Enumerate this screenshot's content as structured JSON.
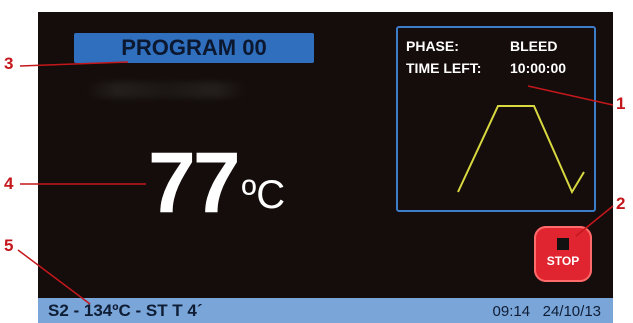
{
  "program": {
    "label": "PROGRAM 00"
  },
  "temperature": {
    "value": "77",
    "unit": "ºC"
  },
  "phase_panel": {
    "phase_label": "PHASE:",
    "phase_value": "BLEED",
    "time_label": "TIME LEFT:",
    "time_value": "10:00:00",
    "curve_color": "#d8d840"
  },
  "stop_button": {
    "label": "STOP",
    "color": "#e02530"
  },
  "status_bar": {
    "cycle": "S2 - 134ºC - ST T 4´",
    "time": "09:14",
    "date": "24/10/13",
    "color": "#79a5d9"
  },
  "callouts": [
    "1",
    "2",
    "3",
    "4",
    "5"
  ],
  "colors": {
    "callout": "#c4171c",
    "accent_blue": "#2f6fbd",
    "screen_bg": "#140d0b"
  }
}
